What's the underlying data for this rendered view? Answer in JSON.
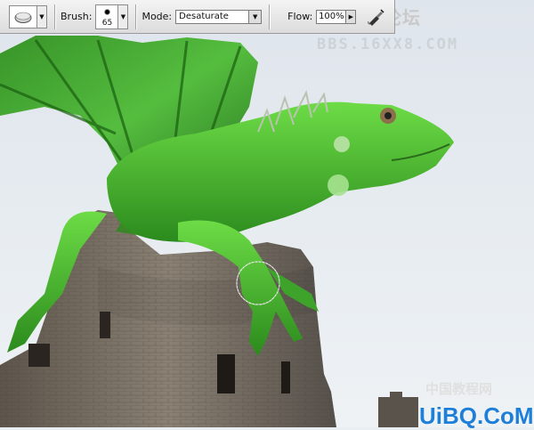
{
  "toolbar": {
    "brush_label": "Brush:",
    "brush_size": "65",
    "mode_label": "Mode:",
    "mode_value": "Desaturate",
    "flow_label": "Flow:",
    "flow_value": "100%"
  },
  "watermarks": {
    "top": "PS教程论坛",
    "top_sub": "BBS.16XX8.COM",
    "bottom_cn": "中国教程网",
    "bottom": "UiBQ.CoM"
  },
  "colors": {
    "sky": "#e9eef3",
    "dragon": "#3fb52a",
    "stone": "#6b6257"
  }
}
